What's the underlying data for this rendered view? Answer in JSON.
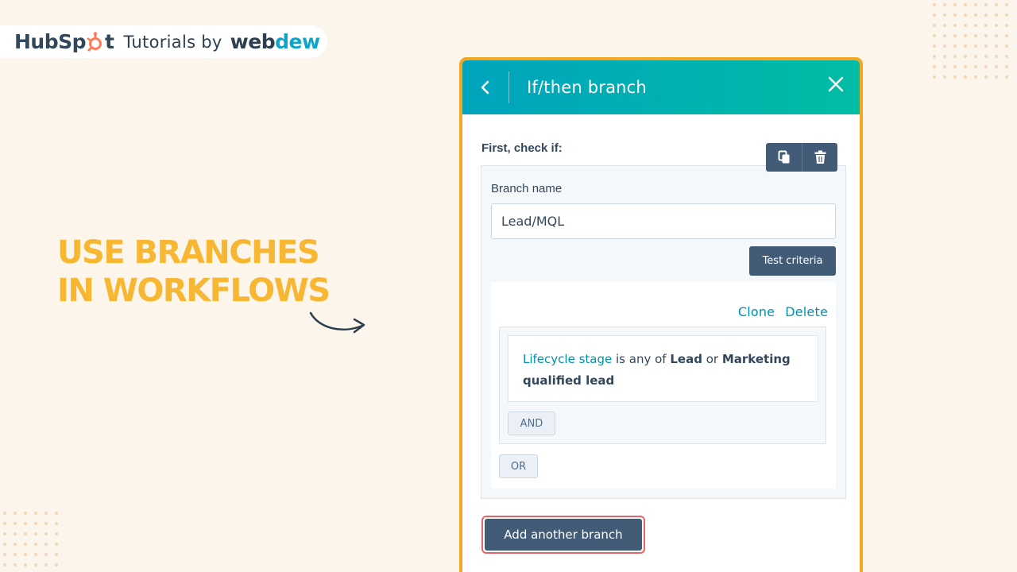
{
  "brand": {
    "hubspot_pre": "HubSp",
    "hubspot_post": "t",
    "tutorials_label": "Tutorials by",
    "webdew_a": "web",
    "webdew_b": "dew"
  },
  "headline": {
    "line1": "USE BRANCHES",
    "line2": "IN WORKFLOWS"
  },
  "panel": {
    "title": "If/then branch",
    "back_icon": "chevron-left-icon",
    "close_icon": "close-icon",
    "first_check_label": "First, check if:",
    "copy_icon": "copy-icon",
    "delete_icon": "trash-icon",
    "branch_name_label": "Branch name",
    "branch_name_value": "Lead/MQL",
    "test_criteria_label": "Test criteria",
    "clone_label": "Clone",
    "delete_label": "Delete",
    "condition": {
      "property": "Lifecycle stage",
      "operator": "is any of",
      "value1": "Lead",
      "joiner": "or",
      "value2": "Marketing qualified lead"
    },
    "and_label": "AND",
    "or_label": "OR",
    "add_branch_label": "Add another branch"
  },
  "colors": {
    "background": "#fbf5ec",
    "headline": "#f7b733",
    "header_start": "#00a4bd",
    "header_end": "#00bda5",
    "panel_border": "#f5a623",
    "primary_button": "#425b76",
    "link": "#0091ae",
    "highlight_border": "#e8646a",
    "hubspot_orange": "#ff7a59"
  }
}
